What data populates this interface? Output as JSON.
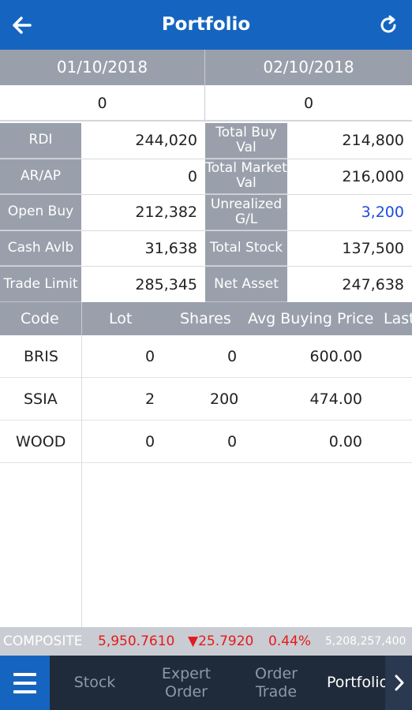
{
  "header": {
    "title": "Portfolio",
    "back_icon": "arrow-left-icon",
    "refresh_icon": "refresh-icon"
  },
  "dates": {
    "left_date": "01/10/2018",
    "right_date": "02/10/2018",
    "left_value": "0",
    "right_value": "0"
  },
  "summary": {
    "rows": [
      {
        "label1": "RDI",
        "value1": "244,020",
        "label2": "Total Buy Val",
        "value2": "214,800"
      },
      {
        "label1": "AR/AP",
        "value1": "0",
        "label2": "Total Market Val",
        "value2": "216,000"
      },
      {
        "label1": "Open Buy",
        "value1": "212,382",
        "label2": "Unrealized G/L",
        "value2": "3,200"
      },
      {
        "label1": "Cash Avlb",
        "value1": "31,638",
        "label2": "Total Stock",
        "value2": "137,500"
      },
      {
        "label1": "Trade Limit",
        "value1": "285,345",
        "label2": "Net Asset",
        "value2": "247,638"
      }
    ]
  },
  "table": {
    "columns": [
      "Code",
      "Lot",
      "Shares",
      "Avg Buying Price",
      "Last"
    ],
    "rows": [
      {
        "code": "BRIS",
        "lot": "0",
        "shares": "0",
        "avg": "600.00"
      },
      {
        "code": "SSIA",
        "lot": "2",
        "shares": "200",
        "avg": "474.00"
      },
      {
        "code": "WOOD",
        "lot": "0",
        "shares": "0",
        "avg": "0.00"
      }
    ]
  },
  "ticker": {
    "name": "COMPOSITE",
    "value": "5,950.7610",
    "change": "▼25.7920",
    "percent": "0.44%",
    "volume": "5,208,257,400"
  },
  "nav": {
    "items": [
      "Stock",
      "Expert Order",
      "Order Trade",
      "Portfolio"
    ],
    "menu_icon": "menu-icon",
    "next_icon": "chevron-right-icon"
  },
  "colors": {
    "header": "#1565c0",
    "label_bg": "#9aa0ab",
    "positive": "#1e4ed8",
    "negative": "#e31b1b",
    "nav_bg": "#1f2b3a"
  }
}
